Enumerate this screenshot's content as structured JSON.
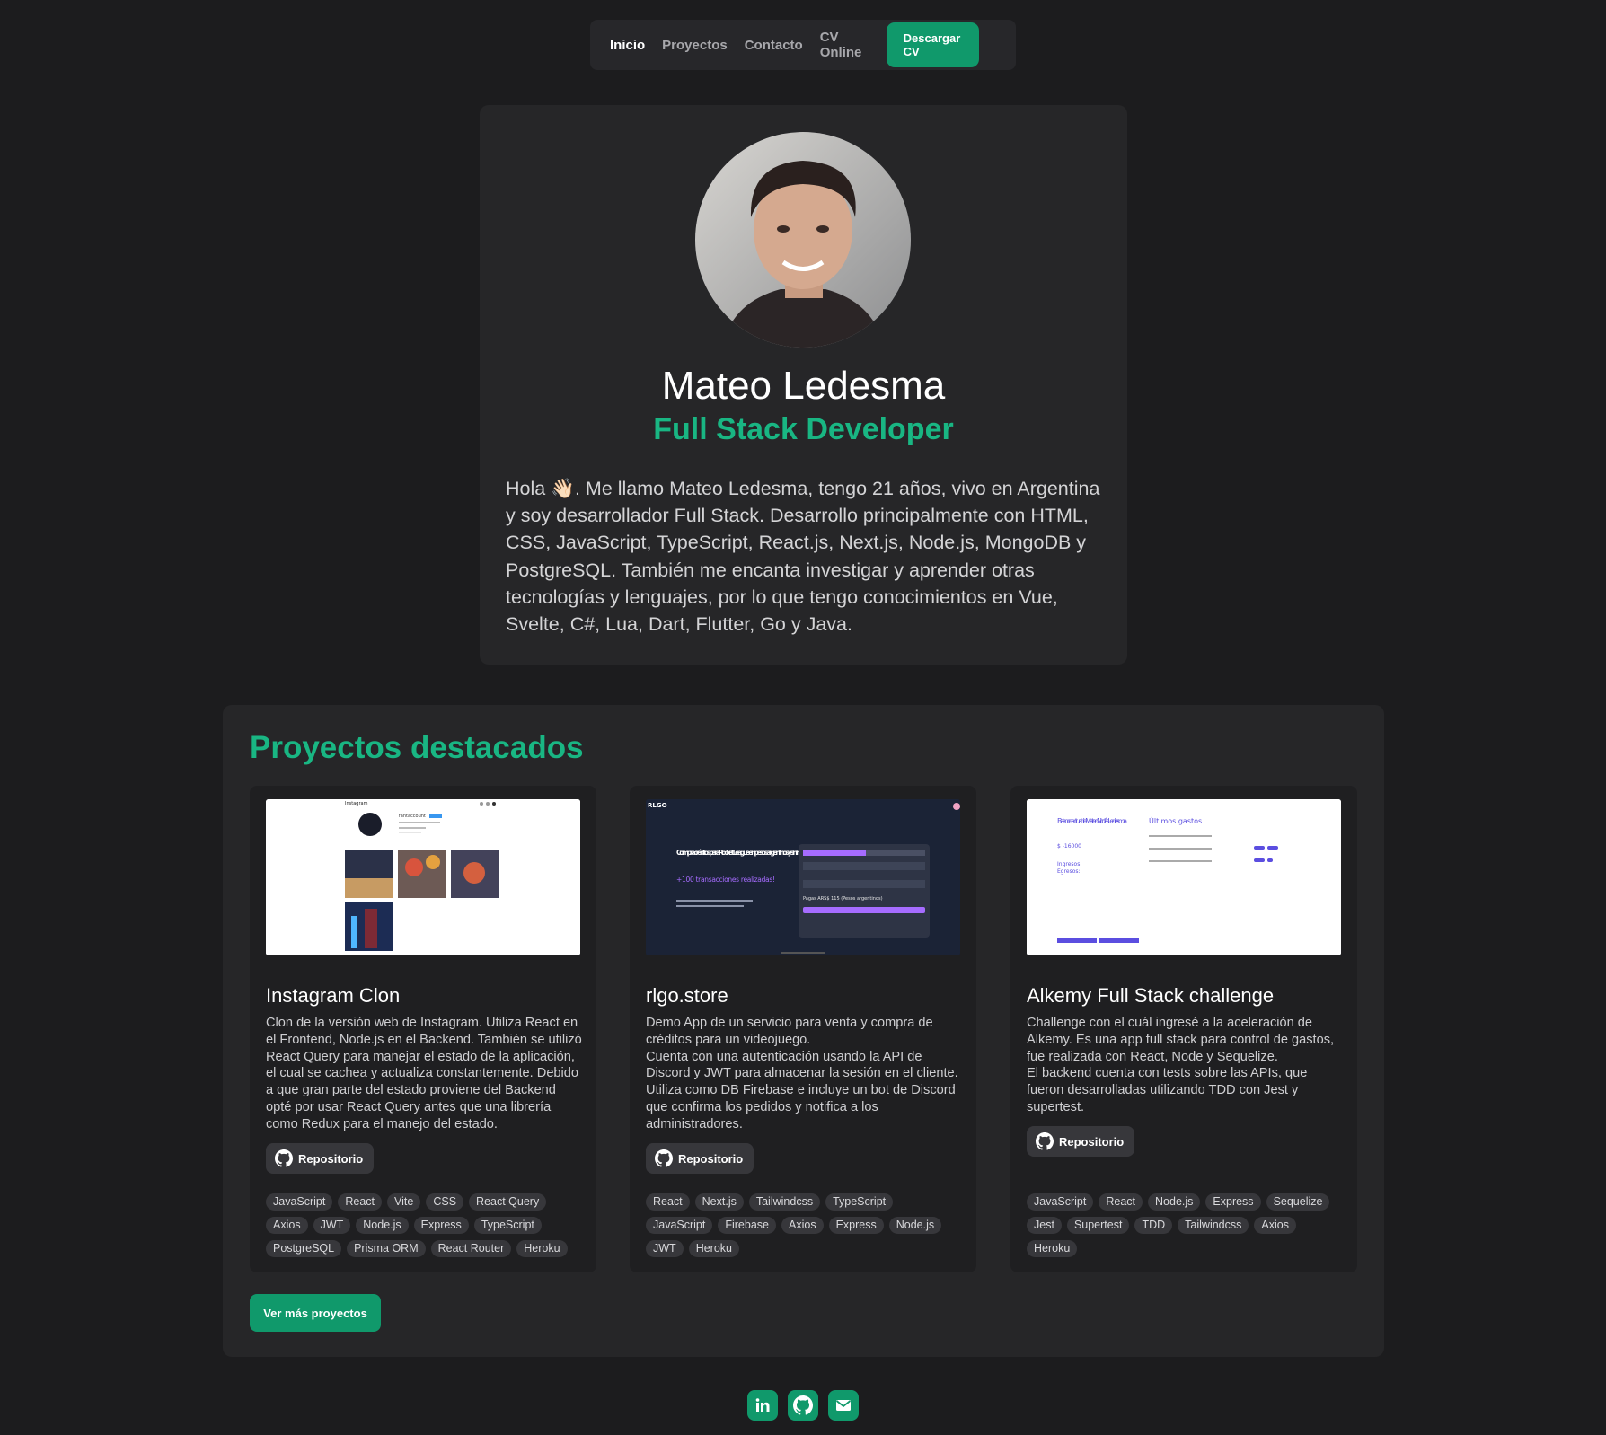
{
  "nav": {
    "items": [
      "Inicio",
      "Proyectos",
      "Contacto",
      "CV Online"
    ],
    "cv_button": "Descargar CV"
  },
  "hero": {
    "name": "Mateo Ledesma",
    "role": "Full Stack Developer",
    "bio": "Hola 👋🏻. Me llamo Mateo Ledesma, tengo 21 años, vivo en Argentina y soy desarrollador Full Stack. Desarrollo principalmente con HTML, CSS, JavaScript, TypeScript, React.js, Next.js, Node.js, MongoDB y PostgreSQL. También me encanta investigar y aprender otras tecnologías y lenguajes, por lo que tengo conocimientos en Vue, Svelte, C#, Lua, Dart, Flutter, Go y Java."
  },
  "projects": {
    "title": "Proyectos destacados",
    "repo_label": "Repositorio",
    "more_button": "Ver más proyectos",
    "cards": [
      {
        "title": "Instagram Clon",
        "description": "Clon de la versión web de Instagram. Utiliza React en el Frontend, Node.js en el Backend. También se utilizó React Query para manejar el estado de la aplicación, el cual se cachea y actualiza constantemente. Debido a que gran parte del estado proviene del Backend opté por usar React Query antes que una librería como Redux para el manejo del estado.",
        "tags": [
          "JavaScript",
          "React",
          "Vite",
          "CSS",
          "React Query",
          "Axios",
          "JWT",
          "Node.js",
          "Express",
          "TypeScript",
          "PostgreSQL",
          "Prisma ORM",
          "React Router",
          "Heroku"
        ]
      },
      {
        "title": "rlgo.store",
        "description": "Demo App de un servicio para venta y compra de créditos para un videojuego.\nCuenta con una autenticación usando la API de Discord y JWT para almacenar la sesión en el cliente. Utiliza como DB Firebase e incluye un bot de Discord que confirma los pedidos y notifica a los administradores.",
        "tags": [
          "React",
          "Next.js",
          "Tailwindcss",
          "TypeScript",
          "JavaScript",
          "Firebase",
          "Axios",
          "Express",
          "Node.js",
          "JWT",
          "Heroku"
        ]
      },
      {
        "title": "Alkemy Full Stack challenge",
        "description": "Challenge con el cuál ingresé a la aceleración de Alkemy. Es una app full stack para control de gastos, fue realizada con React, Node y Sequelize.\nEl backend cuenta con tests sobre las APIs, que fueron desarrolladas utilizando TDD con Jest y supertest.",
        "tags": [
          "JavaScript",
          "React",
          "Node.js",
          "Express",
          "Sequelize",
          "Jest",
          "Supertest",
          "TDD",
          "Tailwindcss",
          "Axios",
          "Heroku"
        ]
      }
    ]
  },
  "thumbs": {
    "ig_brand": "Instagram",
    "ig_user": "fantaccount",
    "rlgo_brand": "RLGO",
    "rlgo_headline": "Compra créditos para Rocket League en pesos argentinos y sin impuestos!",
    "rlgo_sub": "+100 transacciones realizadas!",
    "rlgo_pay": "Pagas ARS$ 115 (Pesos argentinos)",
    "alk_balance": "Balance actual de Mateo Nicolás Ledesma",
    "alk_amount": "$ -16000",
    "alk_ingresos": "Ingresos:",
    "alk_egresos": "Egresos:",
    "alk_last": "Últimos gastos"
  },
  "footer": {
    "icons": [
      "linkedin-icon",
      "github-icon",
      "mail-icon"
    ]
  },
  "colors": {
    "background": "#1c1c1e",
    "card": "#262628",
    "accent": "#19b683",
    "button": "#10996b"
  }
}
